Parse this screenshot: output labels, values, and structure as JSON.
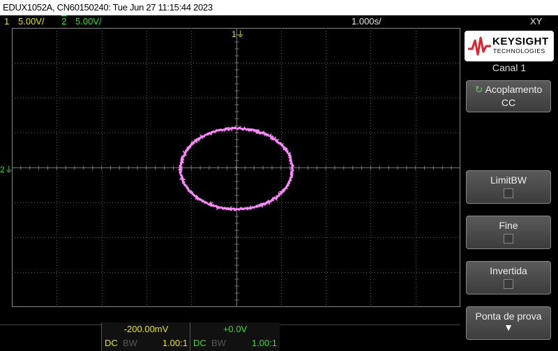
{
  "title_bar": {
    "text": "EDUX1052A, CN60150240: Tue Jun 27 11:15:44 2023"
  },
  "status_bar": {
    "ch1_num": "1",
    "ch1_scale": "5.00V/",
    "ch2_num": "2",
    "ch2_scale": "5.00V/",
    "timebase": "1.000s/",
    "mode": "XY"
  },
  "screen": {
    "ch1_marker": "1",
    "ch2_marker": "2",
    "trace_color": "#ff88ff",
    "grid_color": "#5a5a5a"
  },
  "right_panel": {
    "logo": {
      "name": "KEYSIGHT",
      "sub": "TECHNOLOGIES"
    },
    "menu_title": "Canal 1",
    "buttons": [
      {
        "label": "Acoplamento",
        "value": "CC"
      },
      {
        "label": "LimitBW"
      },
      {
        "label": "Fine"
      },
      {
        "label": "Invertida"
      },
      {
        "label": "Ponta de prova"
      }
    ]
  },
  "bottom_bar": {
    "ch1": {
      "offset": "-200.00mV",
      "coupling": "DC",
      "bw": "BW",
      "probe": "1.00:1"
    },
    "ch2": {
      "offset": "+0.0V",
      "coupling": "DC",
      "bw": "BW",
      "probe": "1.00:1"
    }
  }
}
